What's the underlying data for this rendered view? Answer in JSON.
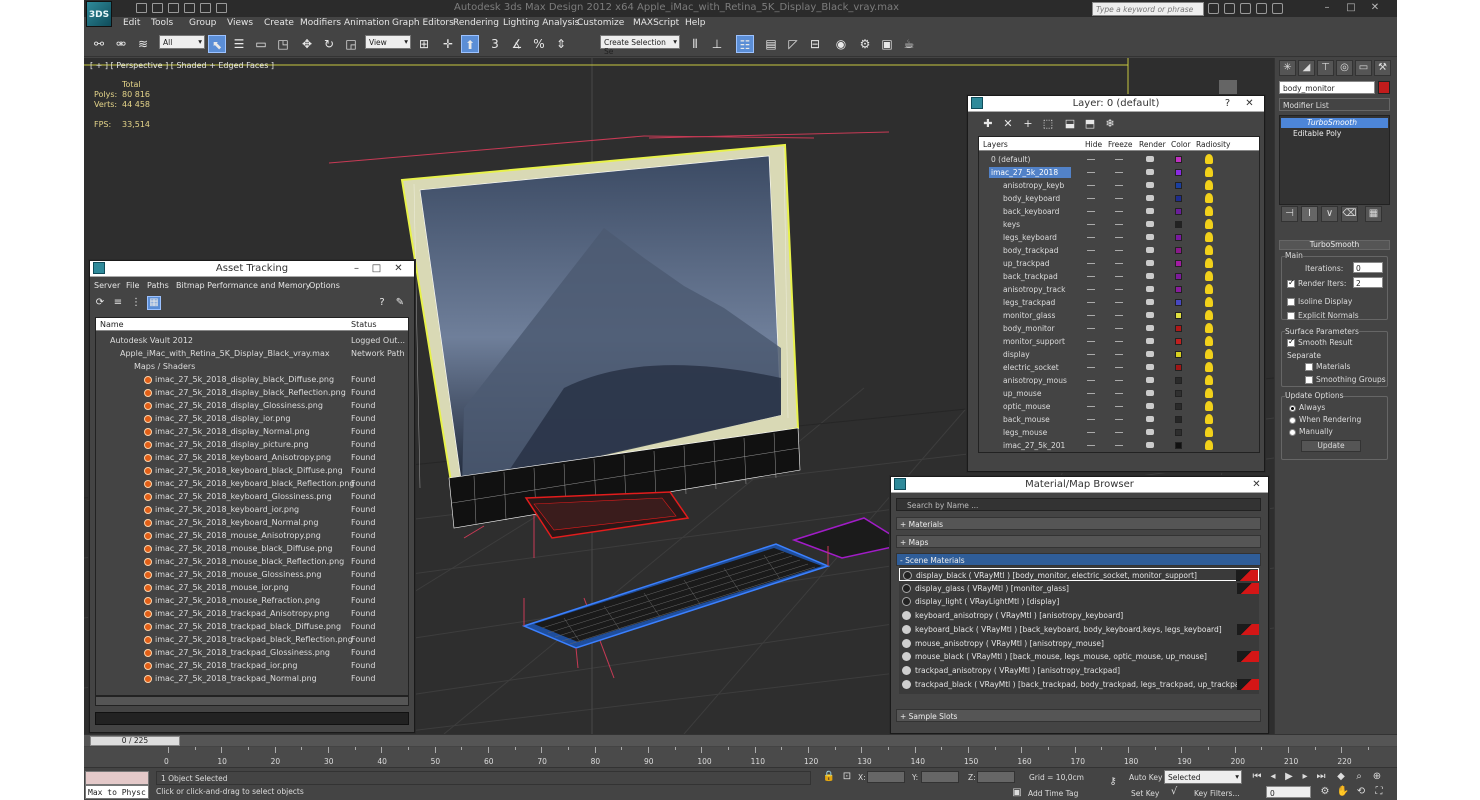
{
  "app": {
    "title": "Autodesk 3ds Max Design 2012 x64      Apple_iMac_with_Retina_5K_Display_Black_vray.max",
    "logo_text": "3DS",
    "search_placeholder": "Type a keyword or phrase"
  },
  "menu": [
    "Edit",
    "Tools",
    "Group",
    "Views",
    "Create",
    "Modifiers",
    "Animation",
    "Graph Editors",
    "Rendering",
    "Lighting Analysis",
    "Customize",
    "MAXScript",
    "Help"
  ],
  "toolbar": {
    "selection_filter": "All",
    "ref_coord": "View",
    "named_selection": "Create Selection Se",
    "snap_label": "3"
  },
  "viewport": {
    "label": "[ + ] [ Perspective ] [ Shaded + Edged Faces ]",
    "stats": {
      "total_label": "Total",
      "polys_label": "Polys:",
      "polys": "80 816",
      "verts_label": "Verts:",
      "verts": "44 458",
      "fps_label": "FPS:",
      "fps": "33,514"
    }
  },
  "command_panel": {
    "object_name": "body_monitor",
    "modifier_list": "Modifier List",
    "stack": [
      "TurboSmooth",
      "Editable Poly"
    ],
    "rollout_title": "TurboSmooth",
    "main_label": "Main",
    "iterations_label": "Iterations:",
    "iterations": "0",
    "render_iters_label": "Render Iters:",
    "render_iters": "2",
    "isoline": "Isoline Display",
    "explicit_normals": "Explicit Normals",
    "surface_params": "Surface Parameters",
    "smooth_result": "Smooth Result",
    "separate": "Separate",
    "materials": "Materials",
    "smoothing_groups": "Smoothing Groups",
    "update_options": "Update Options",
    "always": "Always",
    "when_rendering": "When Rendering",
    "manually": "Manually",
    "update_btn": "Update"
  },
  "asset_tracking": {
    "title": "Asset Tracking",
    "menu": [
      "Server",
      "File",
      "Paths",
      "Bitmap Performance and Memory",
      "Options"
    ],
    "col_name": "Name",
    "col_status": "Status",
    "rows": [
      {
        "name": "Autodesk Vault 2012",
        "status": "Logged Out..."
      },
      {
        "name": "Apple_iMac_with_Retina_5K_Display_Black_vray.max",
        "status": "Network Path"
      },
      {
        "name": "Maps / Shaders",
        "status": ""
      },
      {
        "name": "imac_27_5k_2018_display_black_Diffuse.png",
        "status": "Found"
      },
      {
        "name": "imac_27_5k_2018_display_black_Reflection.png",
        "status": "Found"
      },
      {
        "name": "imac_27_5k_2018_display_Glossiness.png",
        "status": "Found"
      },
      {
        "name": "imac_27_5k_2018_display_ior.png",
        "status": "Found"
      },
      {
        "name": "imac_27_5k_2018_display_Normal.png",
        "status": "Found"
      },
      {
        "name": "imac_27_5k_2018_display_picture.png",
        "status": "Found"
      },
      {
        "name": "imac_27_5k_2018_keyboard_Anisotropy.png",
        "status": "Found"
      },
      {
        "name": "imac_27_5k_2018_keyboard_black_Diffuse.png",
        "status": "Found"
      },
      {
        "name": "imac_27_5k_2018_keyboard_black_Reflection.png",
        "status": "Found"
      },
      {
        "name": "imac_27_5k_2018_keyboard_Glossiness.png",
        "status": "Found"
      },
      {
        "name": "imac_27_5k_2018_keyboard_ior.png",
        "status": "Found"
      },
      {
        "name": "imac_27_5k_2018_keyboard_Normal.png",
        "status": "Found"
      },
      {
        "name": "imac_27_5k_2018_mouse_Anisotropy.png",
        "status": "Found"
      },
      {
        "name": "imac_27_5k_2018_mouse_black_Diffuse.png",
        "status": "Found"
      },
      {
        "name": "imac_27_5k_2018_mouse_black_Reflection.png",
        "status": "Found"
      },
      {
        "name": "imac_27_5k_2018_mouse_Glossiness.png",
        "status": "Found"
      },
      {
        "name": "imac_27_5k_2018_mouse_ior.png",
        "status": "Found"
      },
      {
        "name": "imac_27_5k_2018_mouse_Refraction.png",
        "status": "Found"
      },
      {
        "name": "imac_27_5k_2018_trackpad_Anisotropy.png",
        "status": "Found"
      },
      {
        "name": "imac_27_5k_2018_trackpad_black_Diffuse.png",
        "status": "Found"
      },
      {
        "name": "imac_27_5k_2018_trackpad_black_Reflection.png",
        "status": "Found"
      },
      {
        "name": "imac_27_5k_2018_trackpad_Glossiness.png",
        "status": "Found"
      },
      {
        "name": "imac_27_5k_2018_trackpad_ior.png",
        "status": "Found"
      },
      {
        "name": "imac_27_5k_2018_trackpad_Normal.png",
        "status": "Found"
      }
    ]
  },
  "layer_manager": {
    "title": "Layer: 0 (default)",
    "headers": [
      "Layers",
      "Hide",
      "Freeze",
      "Render",
      "Color",
      "Radiosity"
    ],
    "rows": [
      {
        "name": "0 (default)",
        "color": "#c030c0"
      },
      {
        "name": "imac_27_5k_2018",
        "color": "#8a2be2"
      },
      {
        "name": "anisotropy_keyb",
        "color": "#1a3fa0"
      },
      {
        "name": "body_keyboard",
        "color": "#1e2c8c"
      },
      {
        "name": "back_keyboard",
        "color": "#6a1f9a"
      },
      {
        "name": "keys",
        "color": "#222222"
      },
      {
        "name": "legs_keyboard",
        "color": "#7a1aa0"
      },
      {
        "name": "body_trackpad",
        "color": "#8a1a8a"
      },
      {
        "name": "up_trackpad",
        "color": "#a21ca2"
      },
      {
        "name": "back_trackpad",
        "color": "#7d1b9b"
      },
      {
        "name": "anisotropy_track",
        "color": "#8b1c9e"
      },
      {
        "name": "legs_trackpad",
        "color": "#4848c0"
      },
      {
        "name": "monitor_glass",
        "color": "#e0e040"
      },
      {
        "name": "body_monitor",
        "color": "#b01818"
      },
      {
        "name": "monitor_support",
        "color": "#c02020"
      },
      {
        "name": "display",
        "color": "#d8d020"
      },
      {
        "name": "electric_socket",
        "color": "#a01616"
      },
      {
        "name": "anisotropy_mous",
        "color": "#2a2a2a"
      },
      {
        "name": "up_mouse",
        "color": "#303030"
      },
      {
        "name": "optic_mouse",
        "color": "#2a2a2a"
      },
      {
        "name": "back_mouse",
        "color": "#262626"
      },
      {
        "name": "legs_mouse",
        "color": "#2e2e2e"
      },
      {
        "name": "imac_27_5k_201",
        "color": "#111111"
      }
    ]
  },
  "material_browser": {
    "title": "Material/Map Browser",
    "search_placeholder": "Search by Name ...",
    "groups": [
      "+ Materials",
      "+ Maps",
      "- Scene Materials",
      "+ Sample Slots"
    ],
    "materials": [
      {
        "label": "display_black ( VRayMtl ) [body_monitor, electric_socket, monitor_support]",
        "dark": true,
        "red": true
      },
      {
        "label": "display_glass ( VRayMtl ) [monitor_glass]",
        "dark": true,
        "red": true
      },
      {
        "label": "display_light ( VRayLightMtl ) [display]",
        "dark": true,
        "red": false
      },
      {
        "label": "keyboard_anisotropy ( VRayMtl ) [anisotropy_keyboard]",
        "dark": false,
        "red": false
      },
      {
        "label": "keyboard_black ( VRayMtl ) [back_keyboard, body_keyboard,keys, legs_keyboard]",
        "dark": false,
        "red": true
      },
      {
        "label": "mouse_anisotropy ( VRayMtl ) [anisotropy_mouse]",
        "dark": false,
        "red": false
      },
      {
        "label": "mouse_black ( VRayMtl ) [back_mouse, legs_mouse, optic_mouse, up_mouse]",
        "dark": false,
        "red": true
      },
      {
        "label": "trackpad_anisotropy ( VRayMtl ) [anisotropy_trackpad]",
        "dark": false,
        "red": false
      },
      {
        "label": "trackpad_black ( VRayMtl ) [back_trackpad, body_trackpad, legs_trackpad, up_trackpad]",
        "dark": false,
        "red": true
      }
    ]
  },
  "timeline": {
    "frame": "0 / 225",
    "ticks": [
      "0",
      "10",
      "20",
      "30",
      "40",
      "50",
      "60",
      "70",
      "80",
      "90",
      "100",
      "110",
      "120",
      "130",
      "140",
      "150",
      "160",
      "170",
      "180",
      "190",
      "200",
      "210",
      "220"
    ]
  },
  "status": {
    "maxscript": "Max to Physc",
    "selected": "1 Object Selected",
    "prompt": "Click or click-and-drag to select objects",
    "x_label": "X:",
    "y_label": "Y:",
    "z_label": "Z:",
    "grid": "Grid = 10,0cm",
    "add_time_tag": "Add Time Tag",
    "auto_key": "Auto Key",
    "set_key": "Set Key",
    "selected_combo": "Selected",
    "key_filters": "Key Filters...",
    "frame_field": "0"
  }
}
